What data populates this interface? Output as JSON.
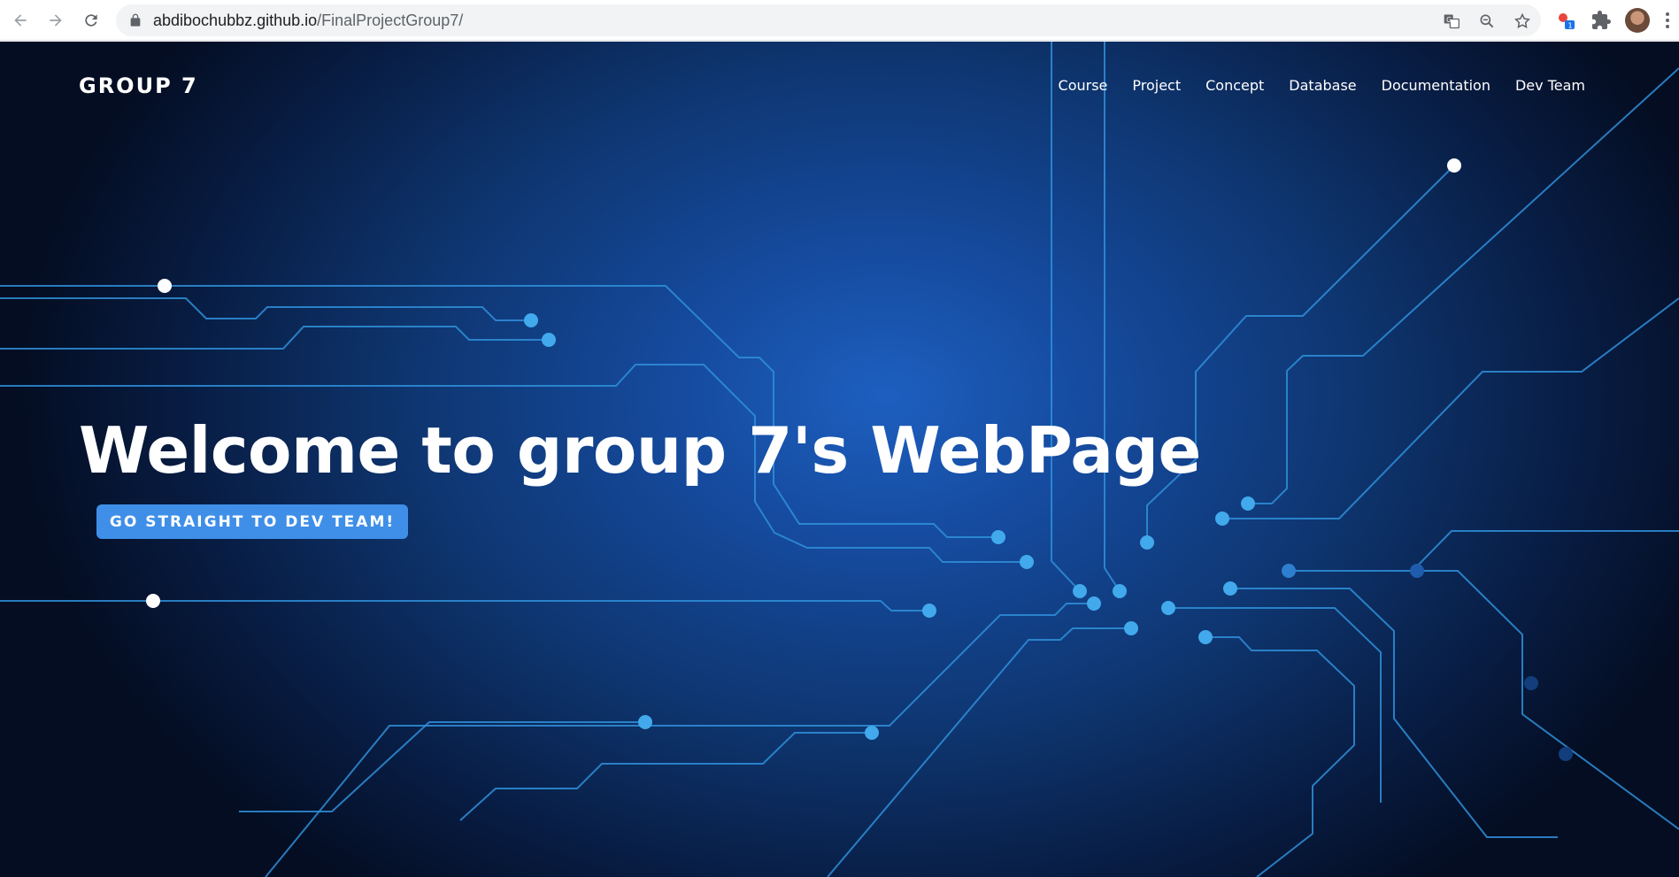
{
  "browser": {
    "url_host": "abdibochubbz.github.io",
    "url_path": "/FinalProjectGroup7/"
  },
  "icons": {
    "back": "arrow-left-icon",
    "forward": "arrow-right-icon",
    "reload": "reload-icon",
    "lock": "lock-icon",
    "translate": "translate-icon",
    "zoom": "zoom-icon",
    "bookmark": "star-icon",
    "extension_badge": "extension-badge-icon",
    "extensions": "puzzle-icon",
    "profile": "avatar",
    "menu": "more-vertical-icon"
  },
  "extension_badge_count": "1",
  "site": {
    "brand": "GROUP 7",
    "nav": [
      "Course",
      "Project",
      "Concept",
      "Database",
      "Documentation",
      "Dev Team"
    ],
    "headline": "Welcome to group 7's WebPage",
    "cta_label": "GO STRAIGHT TO DEV TEAM!"
  },
  "colors": {
    "hero_center": "#1d5fbf",
    "hero_edge": "#040d22",
    "circuit_line": "#3a9fe6",
    "node_fill": "#41a9ec",
    "cta_bg": "#3f8fe8"
  }
}
